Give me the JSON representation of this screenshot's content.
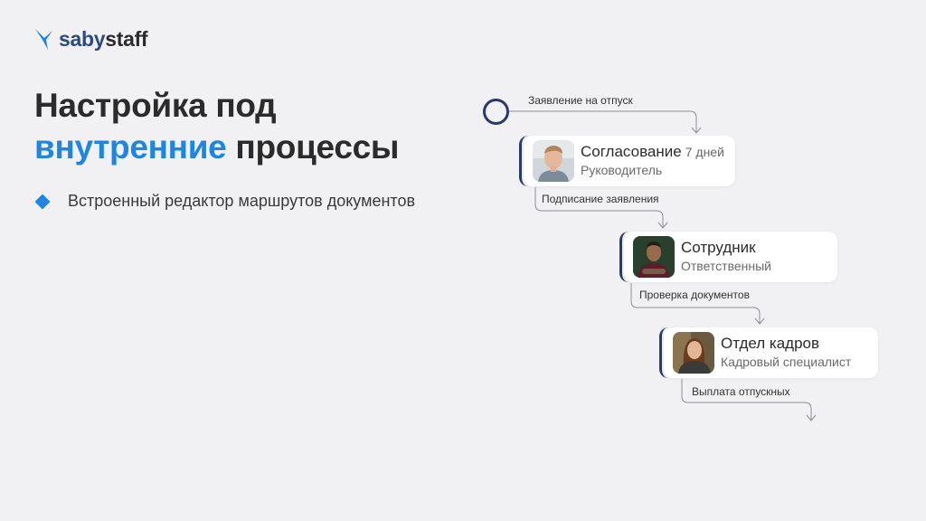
{
  "brand": {
    "part1": "saby",
    "part2": "staff",
    "icon": "saby-bird-icon"
  },
  "heading": {
    "line1": "Настройка под",
    "accent": "внутренние",
    "rest": " процессы"
  },
  "bullet": {
    "text": "Встроенный редактор маршрутов документов"
  },
  "route": {
    "start_label": "Заявление на отпуск",
    "steps": [
      {
        "title": "Согласование",
        "meta": "7 дней",
        "subtitle": "Руководитель",
        "next_label": "Подписание заявления"
      },
      {
        "title": "Сотрудник",
        "meta": "",
        "subtitle": "Ответственный",
        "next_label": "Проверка документов"
      },
      {
        "title": "Отдел кадров",
        "meta": "",
        "subtitle": "Кадровый специалист",
        "next_label": "Выплата отпускных"
      }
    ]
  },
  "colors": {
    "accent": "#1e85e2",
    "navy": "#2c3a6b",
    "background": "#f1f1f4",
    "text": "#2b2b2b"
  }
}
